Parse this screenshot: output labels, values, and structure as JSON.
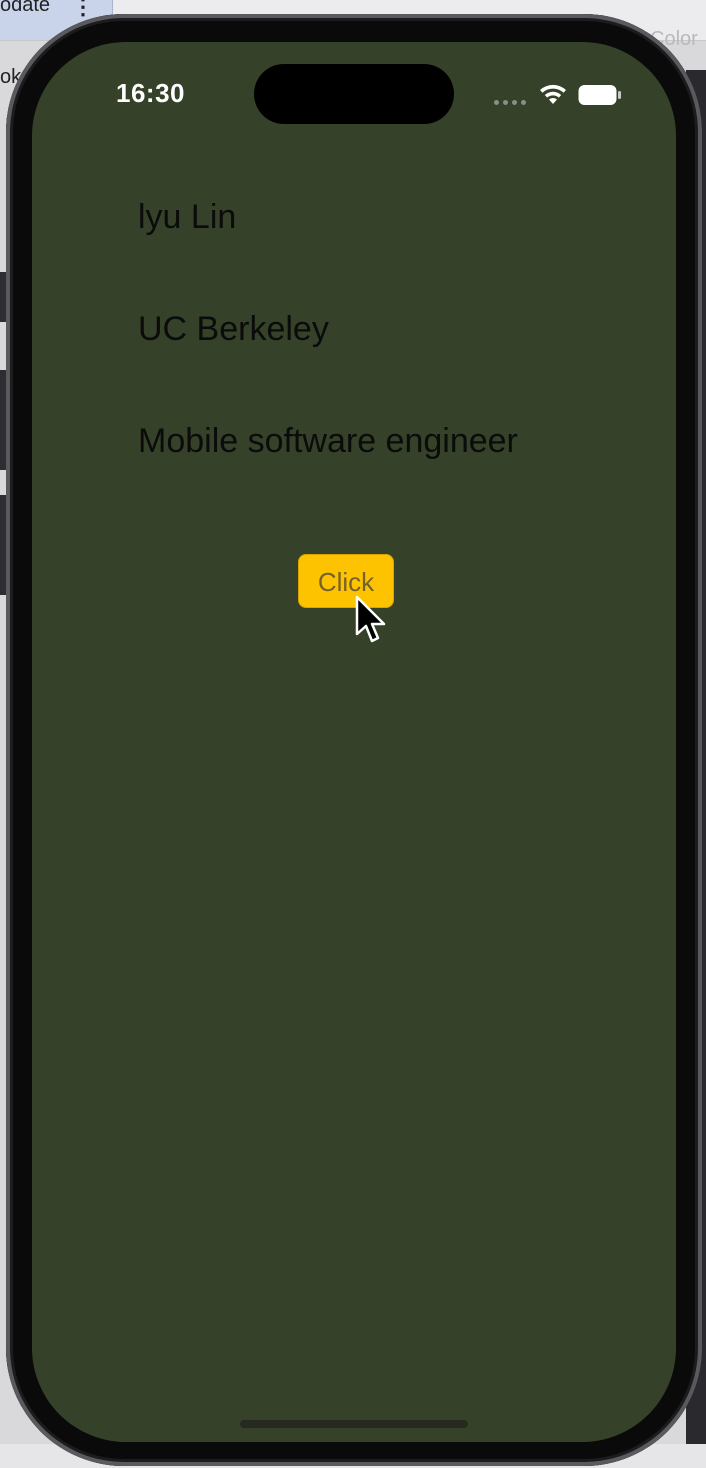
{
  "background": {
    "tab_label": "odate",
    "tab_more_icon": "vertical-ellipsis-icon",
    "right_label": "Color",
    "left_label": "ok"
  },
  "status_bar": {
    "time": "16:30",
    "icons": [
      "cellular-dots-icon",
      "wifi-icon",
      "battery-icon"
    ]
  },
  "profile": {
    "name": "lyu Lin",
    "school": "UC Berkeley",
    "title": "Mobile software engineer"
  },
  "button": {
    "label": "Click",
    "color": "#fdc300"
  },
  "colors": {
    "screen_background": "#354128",
    "text": "#0b0b0b"
  }
}
